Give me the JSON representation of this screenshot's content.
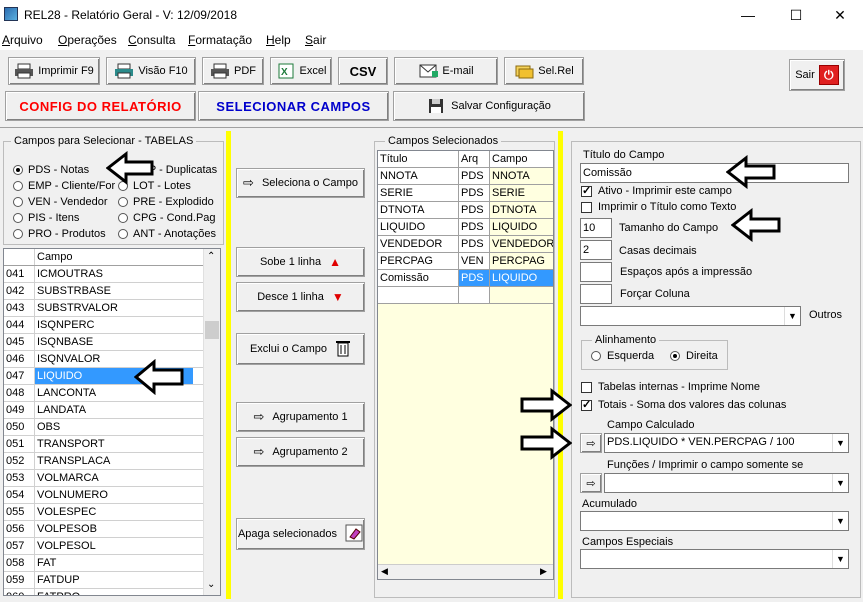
{
  "window": {
    "title": "REL28 - Relatório Geral - V: 12/09/2018",
    "minimize": "—",
    "maximize": "☐",
    "close": "✕"
  },
  "menu": [
    {
      "u": "A",
      "rest": "rquivo"
    },
    {
      "u": "O",
      "rest": "perações"
    },
    {
      "u": "C",
      "rest": "onsulta"
    },
    {
      "u": "F",
      "rest": "ormatação"
    },
    {
      "u": "H",
      "rest": "elp"
    },
    {
      "u": "S",
      "rest": "air"
    }
  ],
  "toolbar": {
    "print": "Imprimir F9",
    "preview": "Visão F10",
    "pdf": "PDF",
    "excel": "Excel",
    "csv": "CSV",
    "email": "E-mail",
    "selrel": "Sel.Rel",
    "exit": "Sair"
  },
  "bigbuttons": {
    "config": "CONFIG  DO  RELATÓRIO",
    "select": "SELECIONAR  CAMPOS",
    "save": "Salvar Configuração"
  },
  "colors": {
    "config": "#ff0000",
    "select": "#0000cc",
    "selection": "#3399ff",
    "yellow": "#ffff00"
  },
  "tables_group": {
    "label": "Campos para Selecionar - TABELAS",
    "options": [
      {
        "label": "PDS - Notas",
        "selected": true
      },
      {
        "label": "DUP - Duplicatas",
        "selected": false
      },
      {
        "label": "EMP - Cliente/Forn",
        "selected": false
      },
      {
        "label": "LOT - Lotes",
        "selected": false
      },
      {
        "label": "VEN - Vendedor",
        "selected": false
      },
      {
        "label": "PRE - Explodido",
        "selected": false
      },
      {
        "label": "PIS - Itens",
        "selected": false
      },
      {
        "label": "CPG - Cond.Pag",
        "selected": false
      },
      {
        "label": "PRO - Produtos",
        "selected": false
      },
      {
        "label": "ANT - Anotações",
        "selected": false
      }
    ]
  },
  "field_list": {
    "header": "Campo",
    "rows": [
      {
        "num": "041",
        "name": "ICMOUTRAS"
      },
      {
        "num": "042",
        "name": "SUBSTRBASE"
      },
      {
        "num": "043",
        "name": "SUBSTRVALOR"
      },
      {
        "num": "044",
        "name": "ISQNPERC"
      },
      {
        "num": "045",
        "name": "ISQNBASE"
      },
      {
        "num": "046",
        "name": "ISQNVALOR"
      },
      {
        "num": "047",
        "name": "LIQUIDO",
        "selected": true
      },
      {
        "num": "048",
        "name": "LANCONTA"
      },
      {
        "num": "049",
        "name": "LANDATA"
      },
      {
        "num": "050",
        "name": "OBS"
      },
      {
        "num": "051",
        "name": "TRANSPORT"
      },
      {
        "num": "052",
        "name": "TRANSPLACA"
      },
      {
        "num": "053",
        "name": "VOLMARCA"
      },
      {
        "num": "054",
        "name": "VOLNUMERO"
      },
      {
        "num": "055",
        "name": "VOLESPEC"
      },
      {
        "num": "056",
        "name": "VOLPESOB"
      },
      {
        "num": "057",
        "name": "VOLPESOL"
      },
      {
        "num": "058",
        "name": "FAT"
      },
      {
        "num": "059",
        "name": "FATDUP"
      },
      {
        "num": "060",
        "name": "FATPRO"
      }
    ]
  },
  "middle_buttons": {
    "select_field": "Seleciona o Campo",
    "up": "Sobe 1 linha",
    "down": "Desce 1 linha",
    "delete": "Exclui o Campo",
    "group1": "Agrupamento 1",
    "group2": "Agrupamento 2",
    "clear": "Apaga selecionados"
  },
  "selected_fields": {
    "label": "Campos Selecionados",
    "headers": [
      "Título",
      "Arq",
      "Campo"
    ],
    "rows": [
      {
        "title": "NNOTA",
        "arq": "PDS",
        "campo": "NNOTA"
      },
      {
        "title": "SERIE",
        "arq": "PDS",
        "campo": "SERIE"
      },
      {
        "title": "DTNOTA",
        "arq": "PDS",
        "campo": "DTNOTA"
      },
      {
        "title": "LIQUIDO",
        "arq": "PDS",
        "campo": "LIQUIDO"
      },
      {
        "title": "VENDEDOR",
        "arq": "PDS",
        "campo": "VENDEDOR"
      },
      {
        "title": "PERCPAG",
        "arq": "VEN",
        "campo": "PERCPAG"
      },
      {
        "title": "Comissão",
        "arq": "PDS",
        "campo": "LIQUIDO",
        "selected": true
      }
    ]
  },
  "props": {
    "title_label": "Título do Campo",
    "title_value": "Comissão",
    "active_label": "Ativo - Imprimir este campo",
    "active": true,
    "print_title_label": "Imprimir o Título como Texto",
    "print_title": false,
    "size_value": "10",
    "size_label": "Tamanho do Campo",
    "decimals_value": "2",
    "decimals_label": "Casas decimais",
    "spaces_value": "",
    "spaces_label": "Espaços após a impressão",
    "force_value": "",
    "force_label": "Forçar Coluna",
    "others_label": "Outros",
    "align_label": "Alinhamento",
    "align_left": "Esquerda",
    "align_right": "Direita",
    "internal_label": "Tabelas internas - Imprime Nome",
    "internal": false,
    "totals_label": "Totais - Soma dos valores das colunas",
    "totals": true,
    "calc_label": "Campo Calculado",
    "calc_value": "PDS.LIQUIDO * VEN.PERCPAG / 100",
    "func_label": "Funções / Imprimir o campo somente se",
    "accum_label": "Acumulado",
    "special_label": "Campos Especiais"
  }
}
